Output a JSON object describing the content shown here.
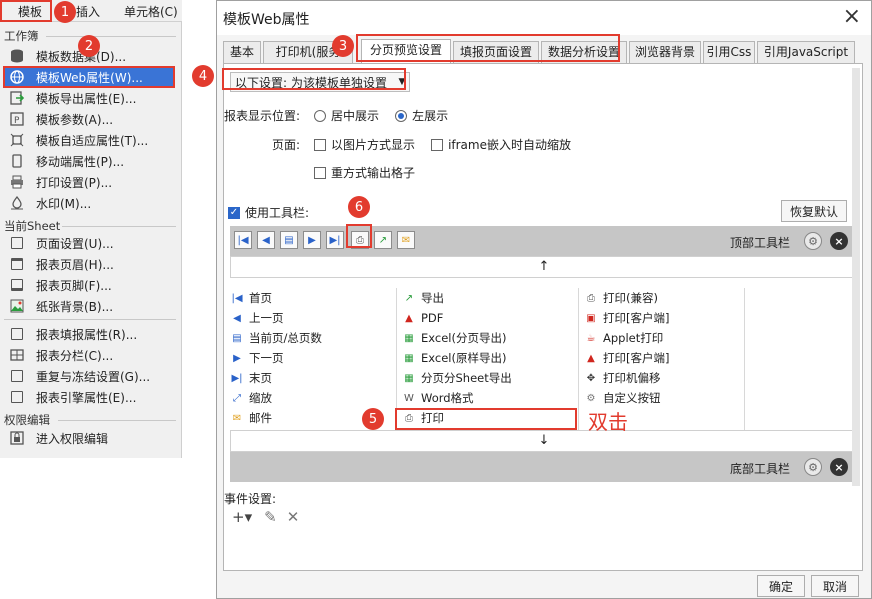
{
  "menubar": {
    "items": [
      "模板",
      "插入",
      "单元格(C)"
    ]
  },
  "menu": {
    "sections": [
      "工作簿",
      "当前Sheet",
      "权限编辑"
    ],
    "workbook_items": [
      {
        "label": "模板数据集(D)...",
        "icon": "database-icon"
      },
      {
        "label": "模板Web属性(W)...",
        "icon": "globe-icon"
      },
      {
        "label": "模板导出属性(E)...",
        "icon": "export-icon"
      },
      {
        "label": "模板参数(A)...",
        "icon": "param-icon"
      },
      {
        "label": "模板自适应属性(T)...",
        "icon": "adaptive-icon"
      },
      {
        "label": "移动端属性(P)...",
        "icon": "mobile-icon"
      },
      {
        "label": "打印设置(P)...",
        "icon": "printer-icon"
      },
      {
        "label": "水印(M)...",
        "icon": "watermark-icon"
      }
    ],
    "sheet_items": [
      {
        "label": "页面设置(U)...",
        "icon": "page-setup-icon"
      },
      {
        "label": "报表页眉(H)...",
        "icon": "header-icon"
      },
      {
        "label": "报表页脚(F)...",
        "icon": "footer-icon"
      },
      {
        "label": "纸张背景(B)...",
        "icon": "background-icon"
      },
      {
        "label": "报表填报属性(R)...",
        "icon": "fill-icon"
      },
      {
        "label": "报表分栏(C)...",
        "icon": "column-icon"
      },
      {
        "label": "重复与冻结设置(G)...",
        "icon": "freeze-icon"
      },
      {
        "label": "报表引擎属性(E)...",
        "icon": "engine-icon"
      }
    ],
    "permission_items": [
      {
        "label": "进入权限编辑",
        "icon": "permission-icon"
      }
    ]
  },
  "dialog": {
    "title": "模板Web属性",
    "tabs": [
      "基本",
      "打印机(服务",
      "分页预览设置",
      "填报页面设置",
      "数据分析设置",
      "浏览器背景",
      "引用Css",
      "引用JavaScript"
    ],
    "settings_prefix": "以下设置:",
    "settings_value": "为该模板单独设置",
    "display_pos_label": "报表显示位置:",
    "display_center": "居中展示",
    "display_left": "左展示",
    "page_label": "页面:",
    "opt_image": "以图片方式显示",
    "opt_iframe": "iframe嵌入时自动缩放",
    "opt_grid": "重方式输出格子",
    "use_toolbar": "使用工具栏:",
    "restore_default": "恢复默认",
    "top_toolbar": "顶部工具栏",
    "bottom_toolbar": "底部工具栏",
    "events_label": "事件设置:",
    "ok": "确定",
    "cancel": "取消",
    "grid_col1": [
      "首页",
      "上一页",
      "当前页/总页数",
      "下一页",
      "末页",
      "缩放",
      "邮件"
    ],
    "grid_col2": [
      "导出",
      "PDF",
      "Excel(分页导出)",
      "Excel(原样导出)",
      "分页分Sheet导出",
      "Word格式",
      "打印"
    ],
    "grid_col3": [
      "打印(兼容)",
      "打印[客户端]",
      "Applet打印",
      "打印[客户端]",
      "打印机偏移",
      "自定义按钮"
    ]
  },
  "annotations": {
    "badges": [
      "1",
      "2",
      "3",
      "4",
      "5",
      "6"
    ],
    "double_click": "双击"
  },
  "colors": {
    "accent": "#3a74d6",
    "annotation": "#e23b2e"
  }
}
